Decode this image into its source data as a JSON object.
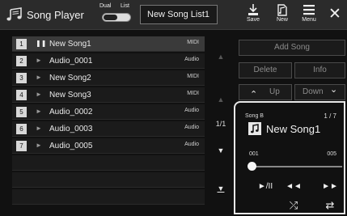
{
  "header": {
    "title": "Song Player",
    "dual_label": "Dual",
    "list_label": "List",
    "songlist_name": "New Song List1",
    "save_label": "Save",
    "new_label": "New",
    "menu_label": "Menu",
    "close_glyph": "✕"
  },
  "songs": [
    {
      "num": "1",
      "name": "New Song1",
      "type": "MIDI",
      "play_glyph": "❚❚"
    },
    {
      "num": "2",
      "name": "Audio_0001",
      "type": "Audio",
      "play_glyph": "►"
    },
    {
      "num": "3",
      "name": "New Song2",
      "type": "MIDI",
      "play_glyph": "►"
    },
    {
      "num": "4",
      "name": "New Song3",
      "type": "MIDI",
      "play_glyph": "►"
    },
    {
      "num": "5",
      "name": "Audio_0002",
      "type": "Audio",
      "play_glyph": "►"
    },
    {
      "num": "6",
      "name": "Audio_0003",
      "type": "Audio",
      "play_glyph": "►"
    },
    {
      "num": "7",
      "name": "Audio_0005",
      "type": "Audio",
      "play_glyph": "►"
    }
  ],
  "scroll": {
    "page": "1/1",
    "top": "▲",
    "up": "▲",
    "down": "▼",
    "bottom": "▼"
  },
  "actions": {
    "add_song": "Add Song",
    "delete": "Delete",
    "info": "Info",
    "up": "Up",
    "down": "Down",
    "up_glyph": "⌃",
    "down_glyph": "⌄"
  },
  "player": {
    "song_label": "Song B",
    "count": "1 / 7",
    "current_song": "New Song1",
    "measure_start": "001",
    "measure_end": "005",
    "position": 0.0,
    "play_pause": "►/II",
    "prev": "◄◄",
    "next": "►►",
    "shuffle": "⤮",
    "repeat": "⇄"
  },
  "colors": {
    "background": "#111111",
    "topbar": "#2b2b2b",
    "selected_row": "#3a3a3a",
    "number_badge": "#d8d8d8"
  }
}
